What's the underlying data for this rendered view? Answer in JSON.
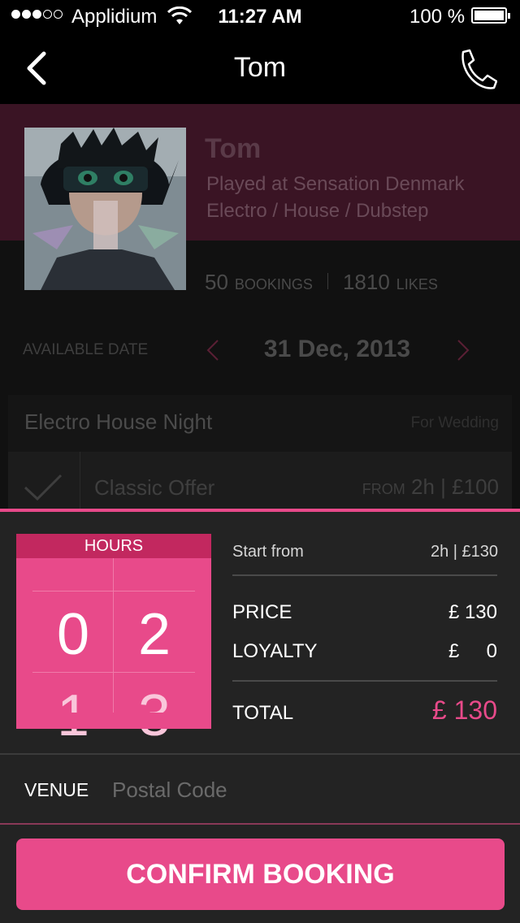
{
  "status_bar": {
    "carrier": "Applidium",
    "time": "11:27 AM",
    "battery": "100 %"
  },
  "nav": {
    "title": "Tom",
    "back_icon": "chevron-left-icon",
    "call_icon": "phone-icon"
  },
  "profile": {
    "name": "Tom",
    "played_at": "Played at Sensation Denmark",
    "genres": "Electro / House / Dubstep",
    "bookings_count": "50",
    "bookings_label": "BOOKINGS",
    "likes_count": "1810",
    "likes_label": "LIKES"
  },
  "availability": {
    "label": "AVAILABLE DATE",
    "date": "31 Dec, 2013"
  },
  "event": {
    "name": "Electro House Night",
    "type": "For Wedding"
  },
  "offer": {
    "name": "Classic Offer",
    "from_label": "FROM",
    "price": "2h | £100"
  },
  "hours_picker": {
    "label": "HOURS",
    "digit1": "0",
    "digit2": "2",
    "next_digit1": "1",
    "next_digit2": "3"
  },
  "summary": {
    "start_from_label": "Start from",
    "start_from_value": "2h | £130",
    "price_label": "PRICE",
    "price_value": "£ 130",
    "loyalty_label": "LOYALTY",
    "loyalty_value": "£     0",
    "total_label": "TOTAL",
    "total_value": "£ 130"
  },
  "venue": {
    "label": "VENUE",
    "placeholder": "Postal Code",
    "value": ""
  },
  "confirm_label": "CONFIRM BOOKING",
  "colors": {
    "accent": "#e84a8a",
    "accent_dark": "#c2285f"
  }
}
